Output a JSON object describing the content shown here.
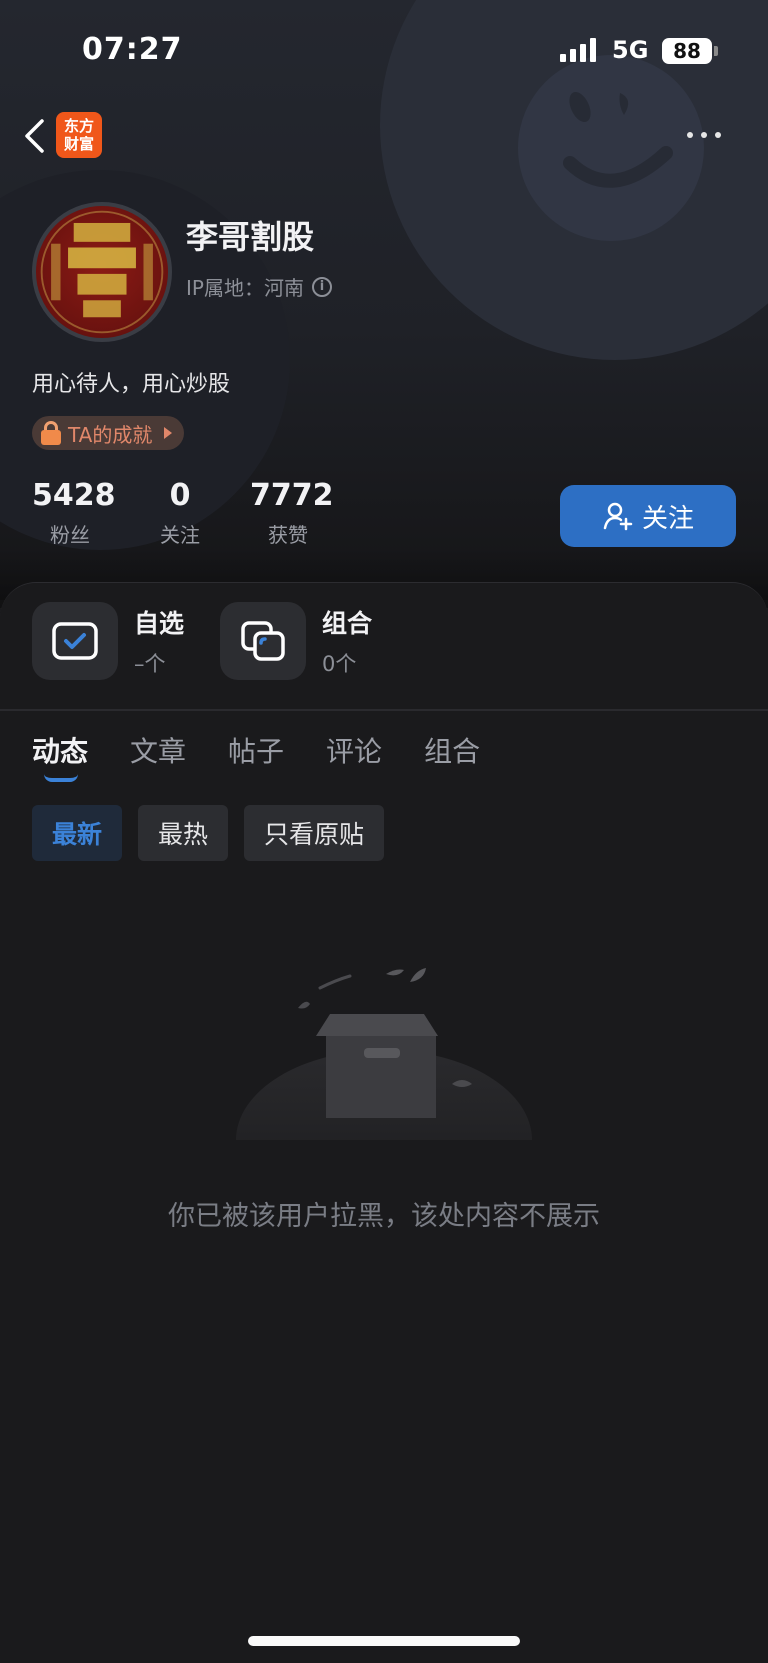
{
  "status_bar": {
    "time": "07:27",
    "network": "5G",
    "battery": "88"
  },
  "nav": {
    "logo_line1": "东方",
    "logo_line2": "财富"
  },
  "profile": {
    "name": "李哥割股",
    "ip_label": "IP属地：河南",
    "bio": "用心待人，用心炒股",
    "achievement": "TA的成就"
  },
  "stats": [
    {
      "value": "5428",
      "label": "粉丝"
    },
    {
      "value": "0",
      "label": "关注"
    },
    {
      "value": "7772",
      "label": "获赞"
    }
  ],
  "follow_button": "关注",
  "quick_links": [
    {
      "title": "自选",
      "sub": "–个"
    },
    {
      "title": "组合",
      "sub": "0个"
    }
  ],
  "tabs": [
    "动态",
    "文章",
    "帖子",
    "评论",
    "组合"
  ],
  "filters": [
    "最新",
    "最热",
    "只看原贴"
  ],
  "empty_message": "你已被该用户拉黑，该处内容不展示",
  "colors": {
    "accent": "#2d6fc4",
    "logo": "#f0571a",
    "background": "#1a1a1c"
  }
}
